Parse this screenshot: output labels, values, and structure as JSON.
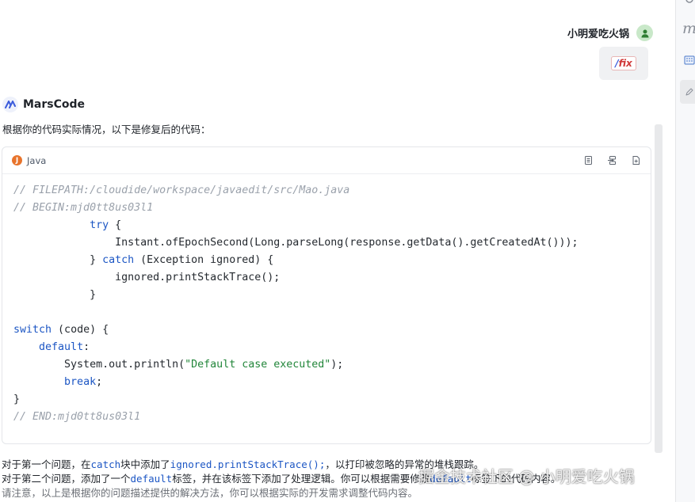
{
  "user": {
    "name": "小明爱吃火锅",
    "command": {
      "slash": "/",
      "name": "fix"
    }
  },
  "assistant": {
    "name": "MarsCode",
    "intro": "根据你的代码实际情况，以下是修复后的代码：",
    "code_block": {
      "language": "Java",
      "lines": [
        [
          {
            "t": "// FILEPATH:/cloudide/workspace/javaedit/src/Mao.java",
            "c": "c"
          }
        ],
        [
          {
            "t": "// BEGIN:mjd0tt8us03l1",
            "c": "c"
          }
        ],
        [
          {
            "t": "            ",
            "c": "p"
          },
          {
            "t": "try",
            "c": "k"
          },
          {
            "t": " {",
            "c": "p"
          }
        ],
        [
          {
            "t": "                Instant.ofEpochSecond(Long.parseLong(response.getData().getCreatedAt()));",
            "c": "p"
          }
        ],
        [
          {
            "t": "            } ",
            "c": "p"
          },
          {
            "t": "catch",
            "c": "k"
          },
          {
            "t": " (Exception ignored) {",
            "c": "p"
          }
        ],
        [
          {
            "t": "                ignored.printStackTrace();",
            "c": "p"
          }
        ],
        [
          {
            "t": "            }",
            "c": "p"
          }
        ],
        [
          {
            "t": "",
            "c": "p"
          }
        ],
        [
          {
            "t": "switch",
            "c": "k"
          },
          {
            "t": " (code) {",
            "c": "p"
          }
        ],
        [
          {
            "t": "    ",
            "c": "p"
          },
          {
            "t": "default",
            "c": "k"
          },
          {
            "t": ":",
            "c": "p"
          }
        ],
        [
          {
            "t": "        System.out.println(",
            "c": "p"
          },
          {
            "t": "\"Default case executed\"",
            "c": "s"
          },
          {
            "t": ");",
            "c": "p"
          }
        ],
        [
          {
            "t": "        ",
            "c": "p"
          },
          {
            "t": "break",
            "c": "k"
          },
          {
            "t": ";",
            "c": "p"
          }
        ],
        [
          {
            "t": "}",
            "c": "p"
          }
        ],
        [
          {
            "t": "// END:mjd0tt8us03l1",
            "c": "c"
          }
        ]
      ]
    },
    "note1": {
      "a": "对于第一个问题，在",
      "b": "catch",
      "c": "块中添加了",
      "d": "ignored.printStackTrace();",
      "e": "，以打印被忽略的异常的堆栈跟踪。"
    },
    "note2": {
      "a": "对于第二个问题，添加了一个",
      "b": "default",
      "c": "标签，并在该标签下添加了处理逻辑。你可以根据需要修改",
      "d": "default",
      "e": "标签下的代码内容。"
    },
    "note3": "请注意，以上是根据你的问题描述提供的解决方法，你可以根据实际的开发需求调整代码内容。"
  },
  "watermark": "掘金技术社区 @ 小明爱吃火锅",
  "rail": {
    "letter": "m"
  },
  "colors": {
    "keyword": "#1c56c4",
    "string": "#22863a",
    "comment": "#9aa1ab",
    "lang_badge": "#e8742c"
  }
}
